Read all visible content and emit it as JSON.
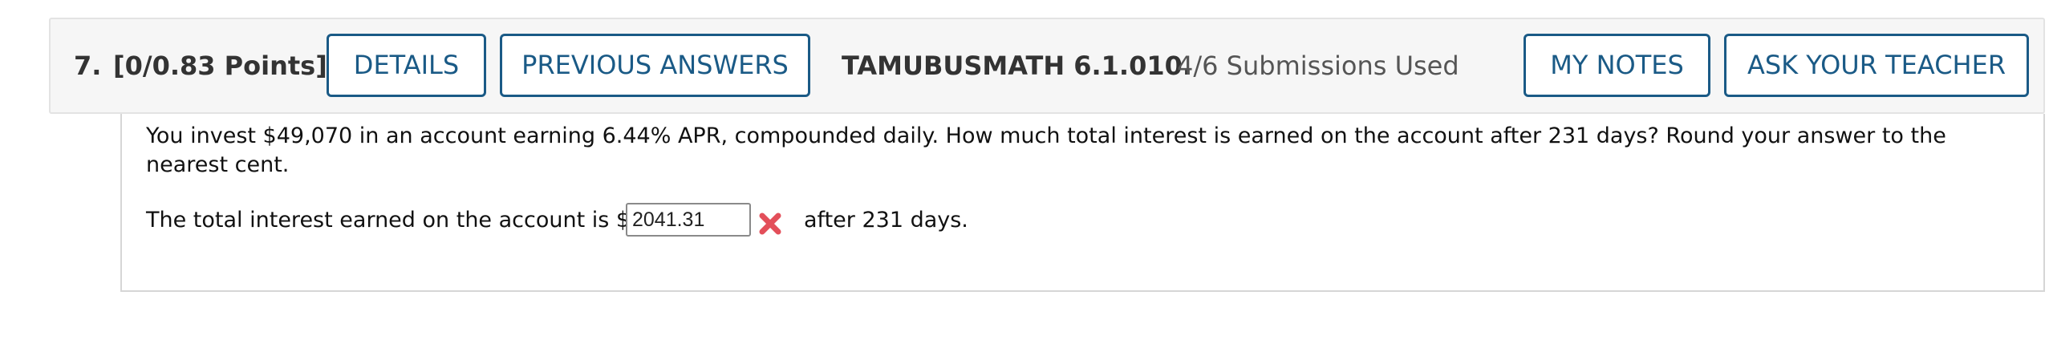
{
  "header": {
    "question_number": "7.",
    "points": "[0/0.83 Points]",
    "details_label": "DETAILS",
    "previous_answers_label": "PREVIOUS ANSWERS",
    "assignment_code": "TAMUBUSMATH 6.1.010.",
    "submissions": "4/6 Submissions Used",
    "my_notes_label": "MY NOTES",
    "ask_teacher_label": "ASK YOUR TEACHER"
  },
  "question": {
    "prompt": "You invest $49,070 in an account earning 6.44% APR, compounded daily. How much total interest is earned on the account after 231 days? Round your answer to the nearest cent.",
    "answer_prefix": "The total interest earned on the account is $",
    "answer_value": "2041.31",
    "answer_status_icon": "incorrect-x-icon",
    "answer_suffix": "after 231 days."
  },
  "colors": {
    "accent": "#1a5a86",
    "incorrect": "#e34f5a",
    "header_background": "#f6f6f6"
  }
}
